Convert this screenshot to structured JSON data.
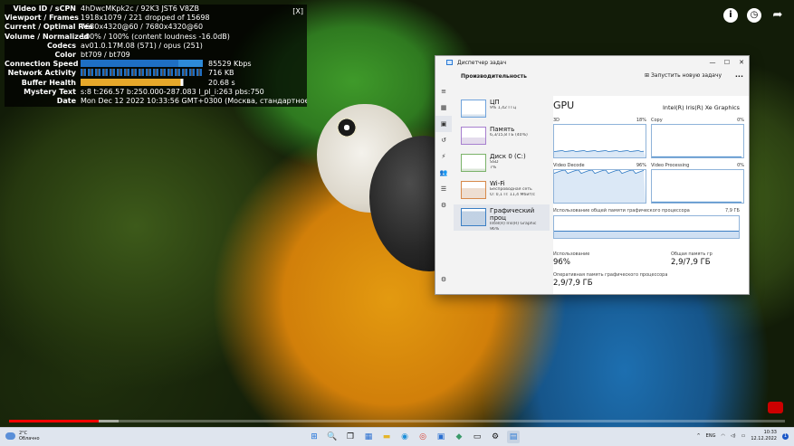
{
  "video": {
    "progress_fraction": 0.115,
    "buffer_fraction": 0.026
  },
  "stats": {
    "close": "[X]",
    "rows": [
      {
        "label": "Video ID / sCPN",
        "value": "4hDwcMKpk2c / 92K3 JST6 V8ZB"
      },
      {
        "label": "Viewport / Frames",
        "value": "1918x1079 / 221 dropped of 15698"
      },
      {
        "label": "Current / Optimal Res",
        "value": "7680x4320@60 / 7680x4320@60"
      },
      {
        "label": "Volume / Normalized",
        "value": "100% / 100% (content loudness -16.0dB)"
      },
      {
        "label": "Codecs",
        "value": "av01.0.17M.08 (571) / opus (251)"
      },
      {
        "label": "Color",
        "value": "bt709 / bt709"
      },
      {
        "label": "Connection Speed",
        "value": "85529 Kbps",
        "graph": "speed"
      },
      {
        "label": "Network Activity",
        "value": "716 KB",
        "graph": "net"
      },
      {
        "label": "Buffer Health",
        "value": "20.68 s",
        "graph": "buffer"
      },
      {
        "label": "Mystery Text",
        "value": "s:8 t:266.57 b:250.000-287.083 l_pl_i:263 pbs:750"
      },
      {
        "label": "Date",
        "value": "Mon Dec 12 2022 10:33:56 GMT+0300 (Москва, стандартное время)"
      }
    ]
  },
  "taskmgr": {
    "title": "Диспетчер задач",
    "section": "Производительность",
    "new_task": "Запустить новую задачу",
    "more": "...",
    "resources": [
      {
        "name": "ЦП",
        "sub": "9% 1,42 ГГц"
      },
      {
        "name": "Память",
        "sub": "6,3/15,8 ГБ (40%)"
      },
      {
        "name": "Диск 0 (C:)",
        "sub": "SSD",
        "sub2": "7%"
      },
      {
        "name": "Wi-Fi",
        "sub": "Беспроводная сеть",
        "sub2": "О: 0,1 П: 11,4 Мбит/с"
      },
      {
        "name": "Графический проц",
        "sub": "Intel(R) Iris(R) Graphic",
        "sub2": "96%"
      }
    ],
    "gpu": {
      "heading": "GPU",
      "name": "Intel(R) Iris(R) Xe Graphics",
      "engines": [
        {
          "name": "3D",
          "pct": "18%",
          "level": 0.18
        },
        {
          "name": "Copy",
          "pct": "0%",
          "level": 0.0
        },
        {
          "name": "Video Decode",
          "pct": "96%",
          "level": 0.96
        },
        {
          "name": "Video Processing",
          "pct": "0%",
          "level": 0.0
        }
      ],
      "mem_label": "Использование общей памяти графического процессора",
      "mem_max": "7,9 ГБ",
      "usage_label": "Использование",
      "usage_value": "96%",
      "shared_label": "Общая память гр",
      "shared_value": "2,9/7,9 ГБ",
      "vram_label": "Оперативная память графического процессора",
      "vram_value": "2,9/7,9 ГБ"
    }
  },
  "taskbar": {
    "temp": "2°C",
    "weather": "Облачно",
    "lang": "ENG",
    "time": "10:33",
    "date": "12.12.2022",
    "notif": "1"
  }
}
